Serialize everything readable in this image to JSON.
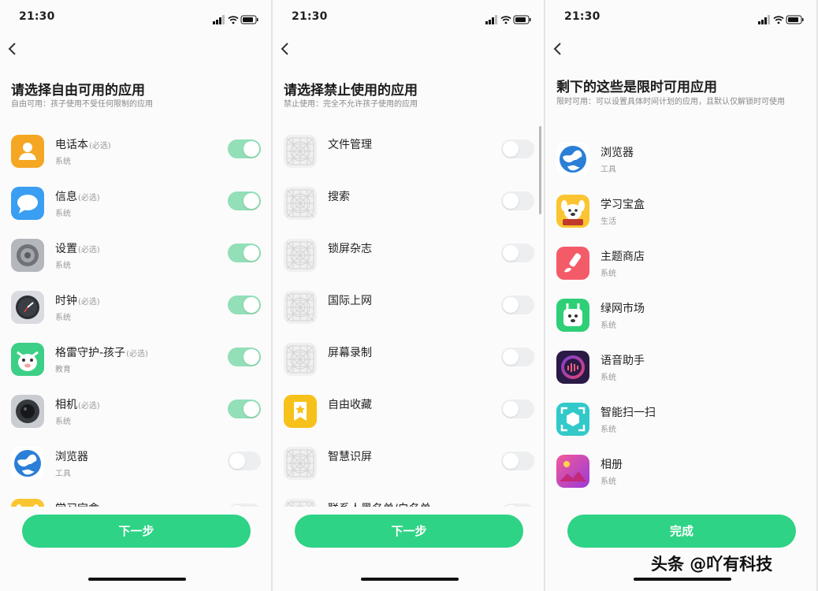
{
  "screens": [
    {
      "time": "21:30",
      "title": "请选择自由可用的应用",
      "subtitle": "自由可用：孩子使用不受任何限制的应用",
      "button_label": "下一步",
      "apps": [
        {
          "name": "电话本",
          "req": "(必选)",
          "tag": "系统",
          "icon": "phone-book-icon",
          "toggle": "on"
        },
        {
          "name": "信息",
          "req": "(必选)",
          "tag": "系统",
          "icon": "messages-icon",
          "toggle": "on"
        },
        {
          "name": "设置",
          "req": "(必选)",
          "tag": "系统",
          "icon": "settings-icon",
          "toggle": "on"
        },
        {
          "name": "时钟",
          "req": "(必选)",
          "tag": "系统",
          "icon": "clock-icon",
          "toggle": "on"
        },
        {
          "name": "格雷守护-孩子",
          "req": "(必选)",
          "tag": "教育",
          "icon": "guardian-app-icon",
          "toggle": "on"
        },
        {
          "name": "相机",
          "req": "(必选)",
          "tag": "系统",
          "icon": "camera-icon",
          "toggle": "on"
        },
        {
          "name": "浏览器",
          "req": "",
          "tag": "工具",
          "icon": "browser-icon",
          "toggle": "off"
        },
        {
          "name": "学习宝盒",
          "req": "",
          "tag": "",
          "icon": "study-box-icon",
          "toggle": "off"
        }
      ]
    },
    {
      "time": "21:30",
      "title": "请选择禁止使用的应用",
      "subtitle": "禁止使用：完全不允许孩子使用的应用",
      "button_label": "下一步",
      "apps": [
        {
          "name": "文件管理",
          "req": "",
          "tag": "",
          "icon": "placeholder-app-icon",
          "toggle": "off"
        },
        {
          "name": "搜索",
          "req": "",
          "tag": "",
          "icon": "placeholder-app-icon",
          "toggle": "off"
        },
        {
          "name": "锁屏杂志",
          "req": "",
          "tag": "",
          "icon": "placeholder-app-icon",
          "toggle": "off"
        },
        {
          "name": "国际上网",
          "req": "",
          "tag": "",
          "icon": "placeholder-app-icon",
          "toggle": "off"
        },
        {
          "name": "屏幕录制",
          "req": "",
          "tag": "",
          "icon": "placeholder-app-icon",
          "toggle": "off"
        },
        {
          "name": "自由收藏",
          "req": "",
          "tag": "",
          "icon": "favorites-icon",
          "toggle": "off"
        },
        {
          "name": "智慧识屏",
          "req": "",
          "tag": "",
          "icon": "placeholder-app-icon",
          "toggle": "off"
        },
        {
          "name": "联系人黑名单/白名单",
          "req": "",
          "tag": "",
          "icon": "placeholder-app-icon",
          "toggle": "off"
        }
      ]
    },
    {
      "time": "21:30",
      "title": "剩下的这些是限时可用应用",
      "subtitle": "限时可用：可以设置具体时间计划的应用，且默认仅解锁时可使用",
      "button_label": "完成",
      "apps": [
        {
          "name": "浏览器",
          "req": "",
          "tag": "工具",
          "icon": "browser-icon",
          "toggle": ""
        },
        {
          "name": "学习宝盒",
          "req": "",
          "tag": "生活",
          "icon": "study-box-icon",
          "toggle": ""
        },
        {
          "name": "主题商店",
          "req": "",
          "tag": "系统",
          "icon": "theme-store-icon",
          "toggle": ""
        },
        {
          "name": "绿网市场",
          "req": "",
          "tag": "系统",
          "icon": "green-market-icon",
          "toggle": ""
        },
        {
          "name": "语音助手",
          "req": "",
          "tag": "系统",
          "icon": "voice-assistant-icon",
          "toggle": ""
        },
        {
          "name": "智能扫一扫",
          "req": "",
          "tag": "系统",
          "icon": "smart-scan-icon",
          "toggle": ""
        },
        {
          "name": "相册",
          "req": "",
          "tag": "系统",
          "icon": "photo-album-icon",
          "toggle": ""
        }
      ]
    }
  ],
  "watermark": "头条 @吖有科技",
  "colors": {
    "accent": "#2ed385",
    "toggle_on": "#92dfb8",
    "toggle_off": "#eceef0",
    "background": "#fbfbfb"
  }
}
